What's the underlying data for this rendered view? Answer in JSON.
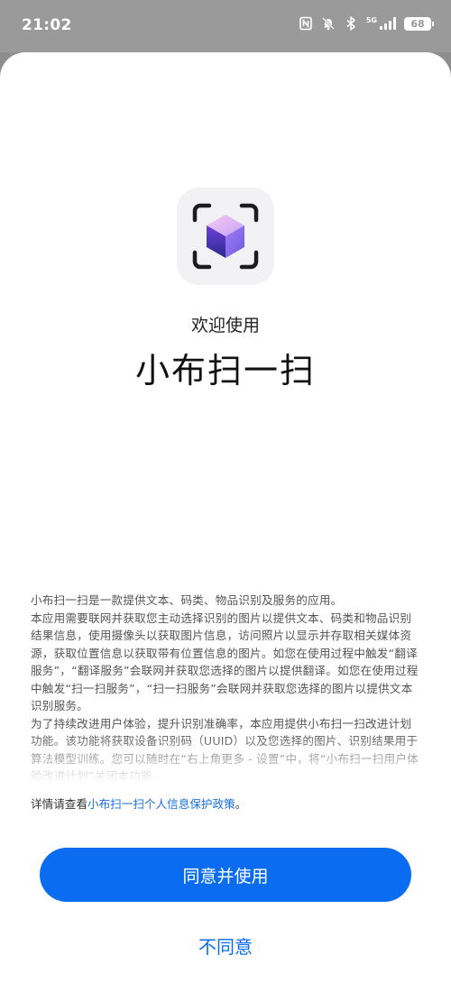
{
  "status_bar": {
    "time": "21:02",
    "network_label": "5G",
    "battery_level": "68",
    "icons": [
      "nfc-icon",
      "bell-off-icon",
      "bluetooth-icon",
      "signal-icon",
      "battery-icon"
    ]
  },
  "app": {
    "icon": "scan-cube-icon",
    "welcome": "欢迎使用",
    "name": "小布扫一扫"
  },
  "description": [
    "小布扫一扫是一款提供文本、码类、物品识别及服务的应用。",
    "本应用需要联网并获取您主动选择识别的图片以提供文本、码类和物品识别结果信息，使用摄像头以获取图片信息，访问照片以显示并存取相关媒体资源，获取位置信息以获取带有位置信息的图片。如您在使用过程中触发“翻译服务”，“翻译服务”会联网并获取您选择的图片以提供翻译。如您在使用过程中触发“扫一扫服务”，“扫一扫服务”会联网并获取您选择的图片以提供文本识别服务。",
    "为了持续改进用户体验，提升识别准确率，本应用提供小布扫一扫改进计划功能。该功能将获取设备识别码（UUID）以及您选择的图片、识别结果用于算法模型训练。您可以随时在“右上角更多 - 设置”中，将“小布扫一扫用户体验改进计划”关闭本功能。"
  ],
  "policy": {
    "prefix": "详情请查看",
    "link": "小布扫一扫个人信息保护政策",
    "suffix": "。"
  },
  "buttons": {
    "agree": "同意并使用",
    "disagree": "不同意"
  },
  "colors": {
    "accent": "#0a6cf0",
    "link": "#1a6fde"
  }
}
